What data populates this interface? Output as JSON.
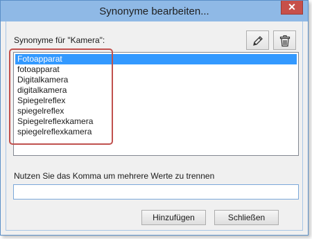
{
  "window": {
    "title": "Synonyme bearbeiten...",
    "close_glyph": "✕"
  },
  "synonyms": {
    "label": "Synonyme für \"Kamera\":",
    "items": [
      "Fotoapparat",
      "fotoapparat",
      "Digitalkamera",
      "digitalkamera",
      "Spiegelreflex",
      "spiegelreflex",
      "Spiegelreflexkamera",
      "spiegelreflexkamera"
    ],
    "selected_index": 0
  },
  "toolbar": {
    "edit_icon": "pencil-icon",
    "delete_icon": "trash-icon"
  },
  "input": {
    "hint": "Nutzen Sie das Komma um mehrere Werte zu trennen",
    "value": ""
  },
  "buttons": {
    "add_label": "Hinzufügen",
    "close_label": "Schließen"
  },
  "colors": {
    "titlebar": "#8fb9e6",
    "selection": "#3399ff",
    "highlight": "#c0504d",
    "close": "#c7504a"
  }
}
